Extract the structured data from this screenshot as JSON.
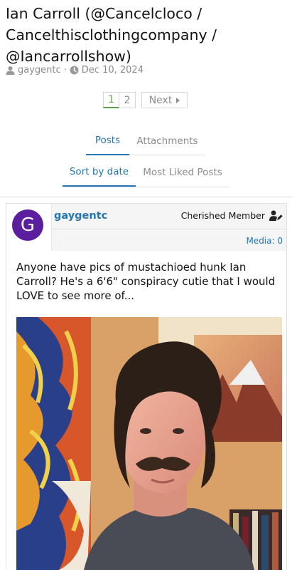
{
  "thread": {
    "title": "Ian Carroll (@Cancelcloco / Cancelthisclothingcompany / @Iancarrollshow)",
    "author": "gaygentc",
    "date": "Dec 10, 2024",
    "separator": "·"
  },
  "pagination": {
    "pages": [
      "1",
      "2"
    ],
    "current": "1",
    "next_label": "Next"
  },
  "tabs": [
    {
      "label": "Posts",
      "active": true
    },
    {
      "label": "Attachments",
      "active": false
    }
  ],
  "sort_tabs": [
    {
      "label": "Sort by date",
      "active": true
    },
    {
      "label": "Most Liked Posts",
      "active": false
    }
  ],
  "post": {
    "avatar_letter": "G",
    "avatar_color": "#5b1e9e",
    "username": "gaygentc",
    "user_title": "Cherished Member",
    "media_count": "Media: 0",
    "message": "Anyone have pics of mustachioed hunk Ian Carroll? He's a 6'6\" conspiracy cutie that I would LOVE to see more of...",
    "image": "photo of man with mustache and shoulder-length hair in grey t-shirt, colorful paintings behind"
  },
  "colors": {
    "link": "#2577b1",
    "muted": "#8c8c8c",
    "text": "#141414"
  }
}
